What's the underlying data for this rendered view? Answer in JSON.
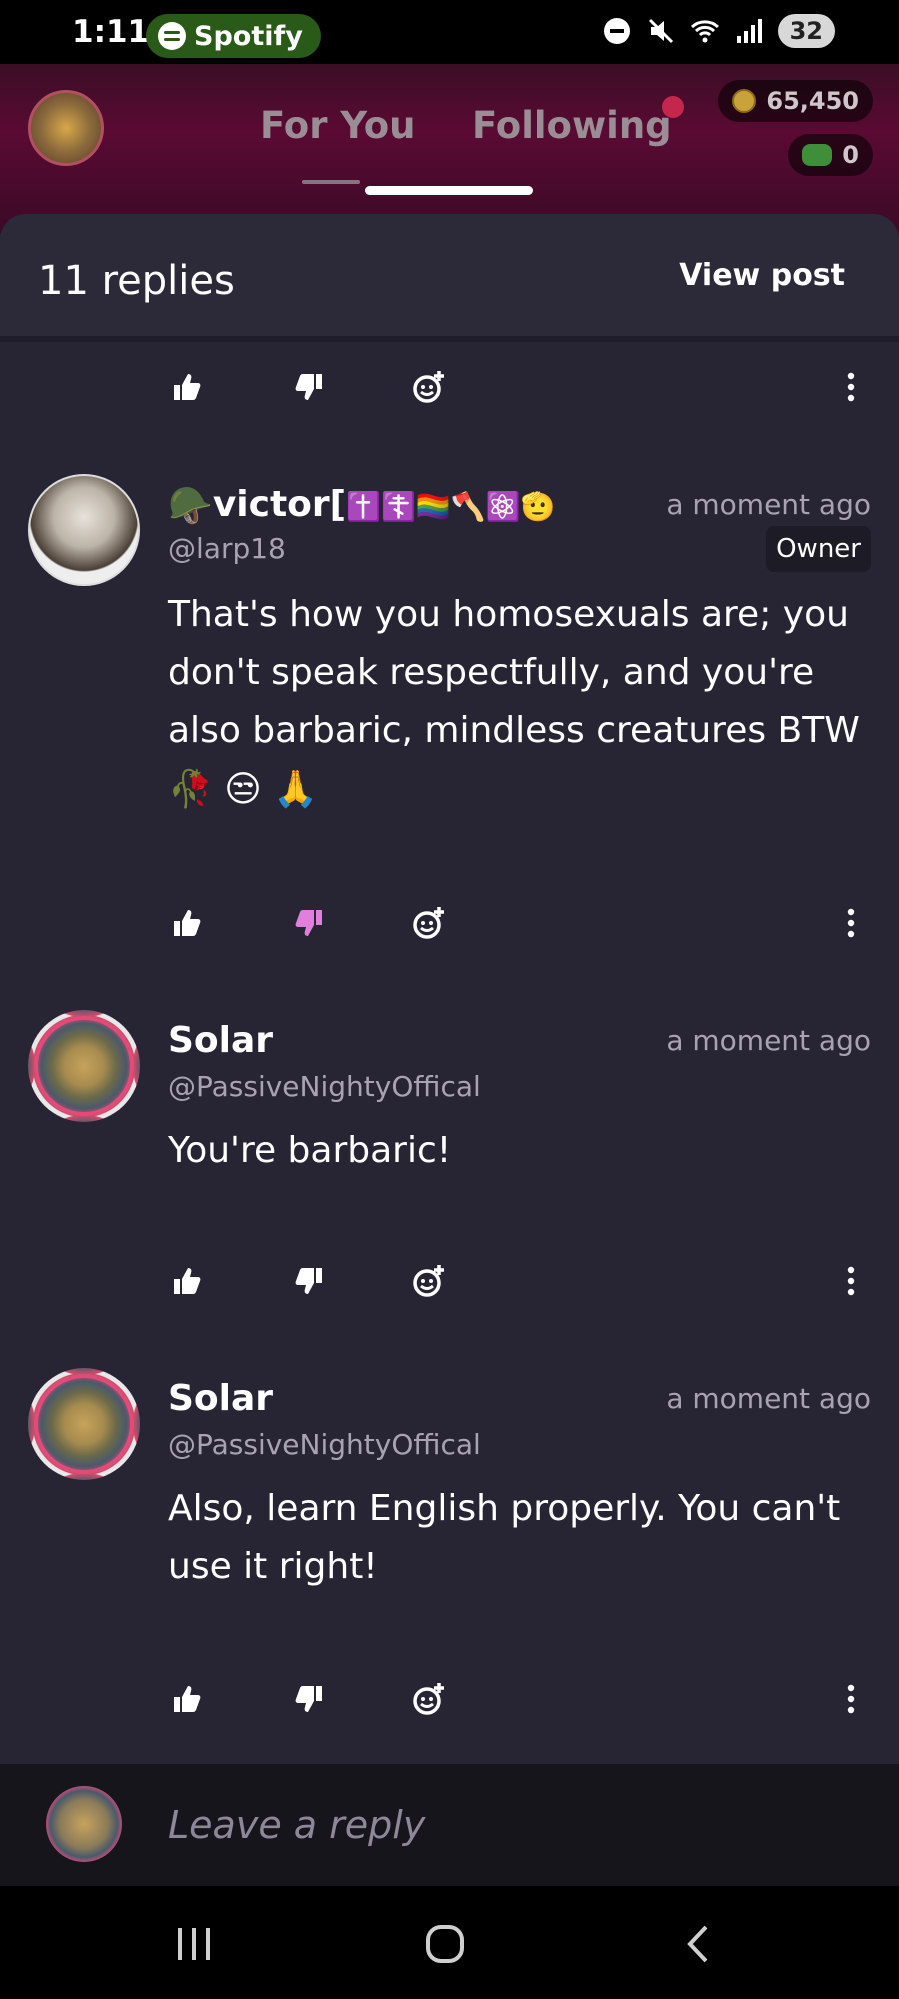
{
  "status_bar": {
    "time": "1:11",
    "now_playing_app": "Spotify",
    "battery": "32"
  },
  "header": {
    "tabs": [
      {
        "label": "For You",
        "active": false
      },
      {
        "label": "Following",
        "active": true
      }
    ],
    "coins": "65,450",
    "cash": "0"
  },
  "thread": {
    "replies_count_label": "11 replies",
    "view_post_label": "View post"
  },
  "comments": [
    {
      "name": "victor[",
      "name_emoji": "🪖",
      "name_suffix_emoji": "✝️☦️🏳️‍🌈🪓⚛️🫡",
      "handle": "@larp18",
      "time": "a moment ago",
      "badge": "Owner",
      "text": "That's how you homosexuals are; you don't speak respectfully, and you're also barbaric, mindless creatures BTW",
      "text_emoji": "🥀 😒 🙏",
      "disliked": true
    },
    {
      "name": "Solar",
      "handle": "@PassiveNightyOffical",
      "time": "a moment ago",
      "text": "You're barbaric!",
      "disliked": false
    },
    {
      "name": "Solar",
      "handle": "@PassiveNightyOffical",
      "time": "a moment ago",
      "text": "Also, learn English properly. You can't use it right!",
      "disliked": false
    }
  ],
  "reply_bar": {
    "placeholder": "Leave a reply"
  },
  "colors": {
    "background": "#272533",
    "accent_dislike": "#e07fdc",
    "header_tint": "#5a0a33",
    "notify_dot": "#c5264d"
  },
  "icons": [
    "thumbs-up-icon",
    "thumbs-down-icon",
    "add-reaction-icon",
    "more-vertical-icon",
    "coin-icon",
    "cash-icon"
  ]
}
